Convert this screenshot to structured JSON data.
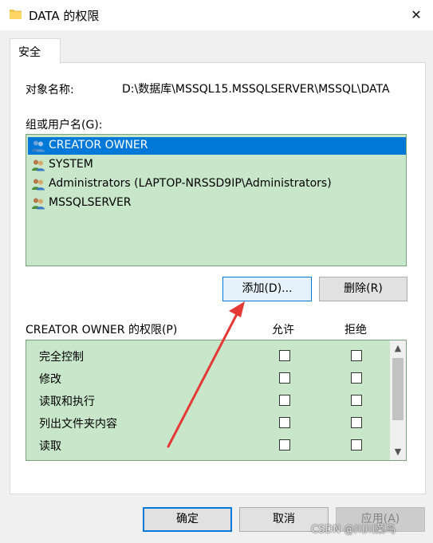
{
  "window": {
    "title": "DATA 的权限",
    "close_glyph": "✕"
  },
  "tabs": [
    {
      "label": "安全",
      "active": true
    }
  ],
  "object": {
    "label": "对象名称:",
    "value": "D:\\数据库\\MSSQL15.MSSQLSERVER\\MSSQL\\DATA"
  },
  "groups": {
    "label": "组或用户名(G):",
    "items": [
      {
        "name": "CREATOR OWNER",
        "selected": true
      },
      {
        "name": "SYSTEM",
        "selected": false
      },
      {
        "name": "Administrators (LAPTOP-NRSSD9IP\\Administrators)",
        "selected": false
      },
      {
        "name": "MSSQLSERVER",
        "selected": false
      }
    ],
    "add_label": "添加(D)...",
    "remove_label": "删除(R)"
  },
  "permissions": {
    "label": "CREATOR OWNER 的权限(P)",
    "allow_header": "允许",
    "deny_header": "拒绝",
    "items": [
      {
        "name": "完全控制",
        "allow": false,
        "deny": false
      },
      {
        "name": "修改",
        "allow": false,
        "deny": false
      },
      {
        "name": "读取和执行",
        "allow": false,
        "deny": false
      },
      {
        "name": "列出文件夹内容",
        "allow": false,
        "deny": false
      },
      {
        "name": "读取",
        "allow": false,
        "deny": false
      }
    ]
  },
  "footer": {
    "ok_label": "确定",
    "cancel_label": "取消",
    "apply_label": "应用(A)"
  },
  "watermark": "CSDN @川川菜鸟",
  "colors": {
    "list_bg": "#c8e6c9",
    "selection": "#0078d7",
    "annotation_arrow": "#e53935"
  }
}
